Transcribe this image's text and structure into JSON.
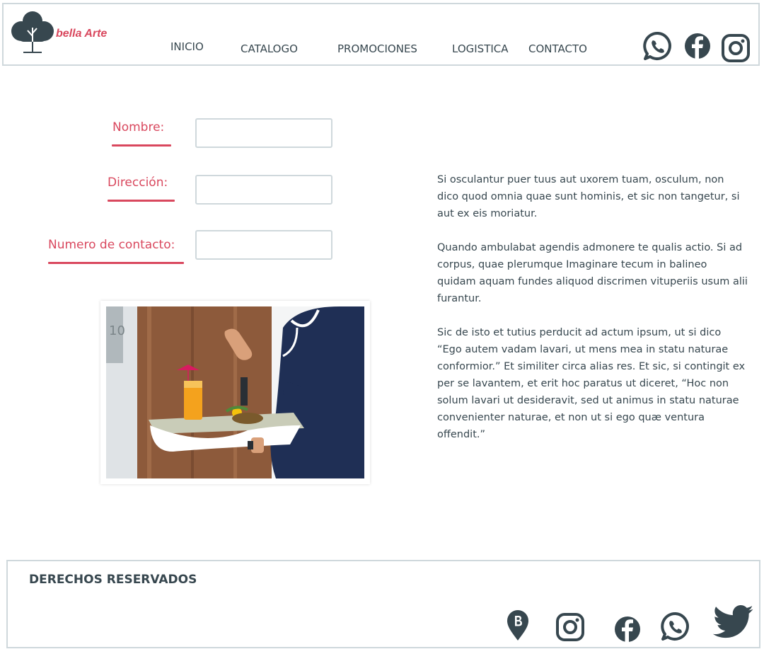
{
  "brand": {
    "name": "bella Arte",
    "logo_icon": "tree-icon"
  },
  "nav": {
    "items": [
      {
        "label": "INICIO"
      },
      {
        "label": "CATALOGO"
      },
      {
        "label": "PROMOCIONES"
      },
      {
        "label": "LOGISTICA"
      },
      {
        "label": "CONTACTO"
      }
    ]
  },
  "header_icons": [
    "whatsapp-icon",
    "facebook-icon",
    "instagram-icon"
  ],
  "form": {
    "nombre_label": "Nombre:",
    "direccion_label": "Dirección:",
    "contacto_label": "Numero de contacto:",
    "nombre_value": "",
    "direccion_value": "",
    "contacto_value": ""
  },
  "content": {
    "paragraphs": [
      "Si osculantur puer tuus aut uxorem tuam, osculum, non dico quod omnia quae sunt hominis, et sic non tangetur, si aut ex eis moriatur.",
      "Quando ambulabat agendis admonere te qualis actio. Si ad corpus, quae plerumque Imaginare tecum in balineo quidam aquam fundes aliquod discrimen vituperiis usum alii furantur.",
      "Sic de isto et tutius perducit ad actum ipsum, ut si dico “Ego autem vadam lavari, ut mens mea in statu naturae conformior.” Et similiter circa alias res. Et sic, si contingit ex per se lavantem, et erit hoc paratus ut diceret, “Hoc non solum lavari ut desideravit, sed ut animus in statu naturae convenienter naturae, et non ut si ego quæ ventura offendit.”"
    ]
  },
  "photo": {
    "door_number": "10"
  },
  "footer": {
    "title": "DERECHOS RESERVADOS",
    "icons": [
      "location-b-icon",
      "instagram-icon",
      "facebook-icon",
      "whatsapp-icon",
      "twitter-icon"
    ]
  },
  "colors": {
    "accent": "#d9485e",
    "icon": "#37474f",
    "border": "#cfd8dc"
  }
}
